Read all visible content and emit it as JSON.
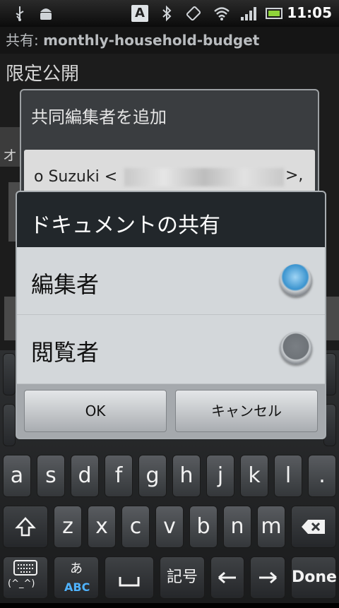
{
  "status_bar": {
    "time": "11:05",
    "icons": [
      "usb-icon",
      "android-debug-icon",
      "text-input-icon",
      "bluetooth-icon",
      "rotation-icon",
      "wifi-icon",
      "signal-icon",
      "battery-icon"
    ],
    "input_indicator": "A"
  },
  "background_app": {
    "title_prefix": "共有: ",
    "title_name": "monthly-household-budget",
    "heading": "限定公開",
    "add_dialog_title": "共同編集者を追加",
    "collaborator_text": "o Suzuki <",
    "collaborator_text_end": ">,",
    "side_fragment": "オ"
  },
  "dialog": {
    "title": "ドキュメントの共有",
    "options": [
      {
        "label": "編集者",
        "selected": true
      },
      {
        "label": "閲覧者",
        "selected": false
      }
    ],
    "ok_label": "OK",
    "cancel_label": "キャンセル"
  },
  "keyboard": {
    "row_letters": [
      "a",
      "s",
      "d",
      "f",
      "g",
      "h",
      "j",
      "k",
      "l",
      "."
    ],
    "row_shift": [
      "z",
      "x",
      "c",
      "v",
      "b",
      "n",
      "m"
    ],
    "symbols_label": "記号",
    "done_label": "Done",
    "kana_label_top": "あ",
    "kana_label_bottom": "ABC",
    "emoticon_label": "(^_^)",
    "colors": {
      "accent_radio": "#3b94cf"
    }
  }
}
